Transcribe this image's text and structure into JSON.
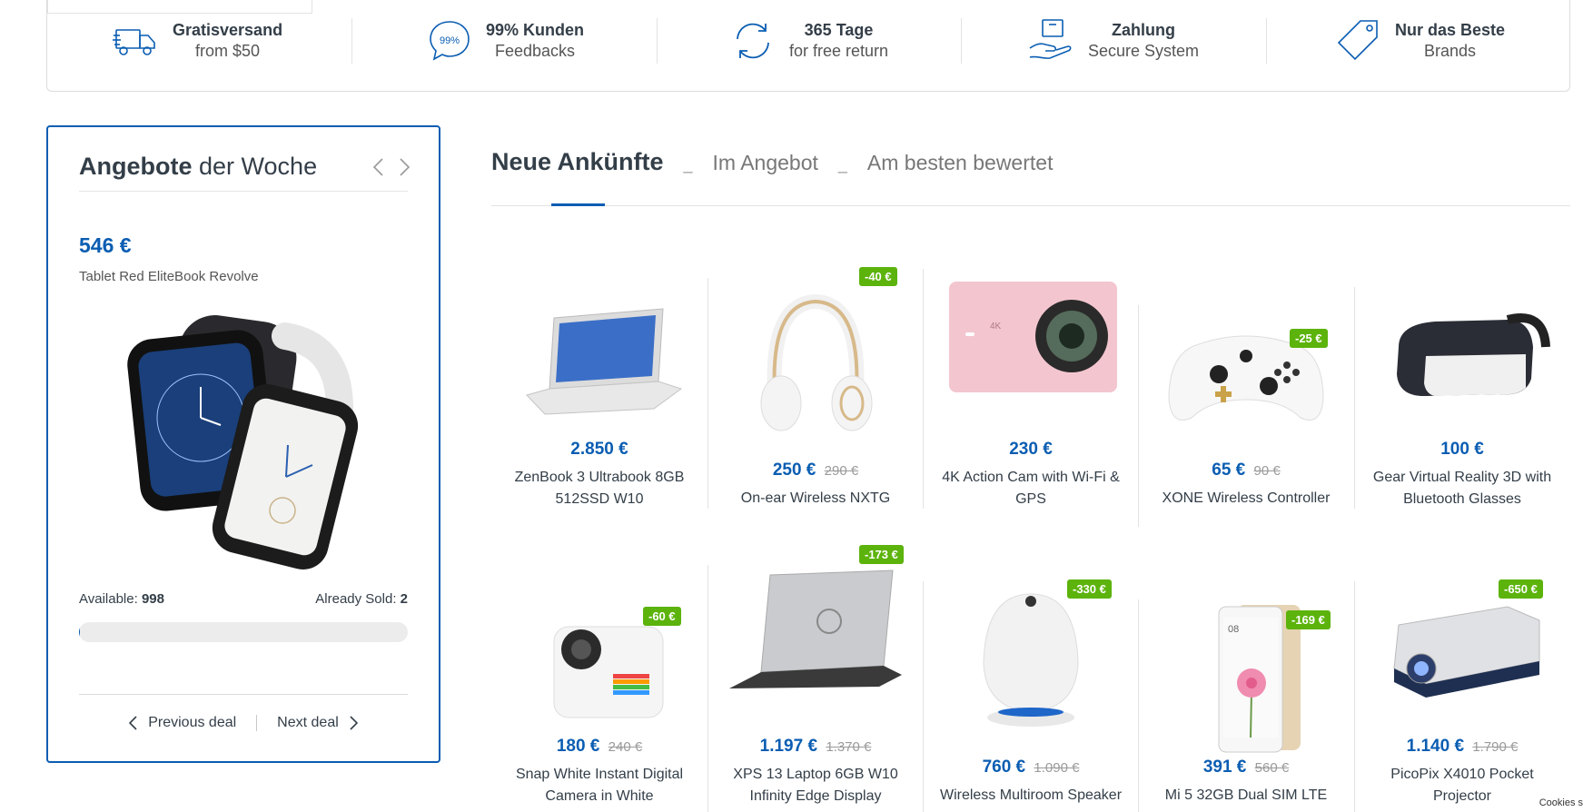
{
  "features": [
    {
      "icon": "truck-icon",
      "title": "Gratisversand",
      "subtitle": "from $50"
    },
    {
      "icon": "feedback-bubble-icon",
      "icon_text": "99%",
      "title": "99% Kunden",
      "subtitle": "Feedbacks"
    },
    {
      "icon": "return-arrows-icon",
      "title": "365 Tage",
      "subtitle": "for free return"
    },
    {
      "icon": "secure-payment-icon",
      "title": "Zahlung",
      "subtitle": "Secure System"
    },
    {
      "icon": "price-tag-icon",
      "title": "Nur das Beste",
      "subtitle": "Brands"
    }
  ],
  "deal": {
    "title_bold": "Angebote",
    "title_light": "der Woche",
    "price": "546 €",
    "product_name": "Tablet Red EliteBook Revolve",
    "available_label": "Available:",
    "available_value": "998",
    "sold_label": "Already Sold:",
    "sold_value": "2",
    "progress_percent": 0.2,
    "prev_label": "Previous deal",
    "next_label": "Next deal"
  },
  "tabs": [
    {
      "label": "Neue Ankünfte",
      "active": true
    },
    {
      "label": "Im Angebot",
      "active": false
    },
    {
      "label": "Am besten bewertet",
      "active": false
    }
  ],
  "tab_separator": "_",
  "products": [
    {
      "name": "ZenBook 3 Ultrabook 8GB 512SSD W10",
      "price": "2.850 €",
      "old_price": "",
      "badge": ""
    },
    {
      "name": "On-ear Wireless NXTG",
      "price": "250 €",
      "old_price": "290 €",
      "badge": "-40 €"
    },
    {
      "name": "4K Action Cam with Wi-Fi & GPS",
      "price": "230 €",
      "old_price": "",
      "badge": ""
    },
    {
      "name": "XONE Wireless Controller",
      "price": "65 €",
      "old_price": "90 €",
      "badge": "-25 €"
    },
    {
      "name": "Gear Virtual Reality 3D with Bluetooth Glasses",
      "price": "100 €",
      "old_price": "",
      "badge": ""
    },
    {
      "name": "Snap White Instant Digital Camera in White",
      "price": "180 €",
      "old_price": "240 €",
      "badge": "-60 €"
    },
    {
      "name": "XPS 13 Laptop 6GB W10 Infinity Edge Display",
      "price": "1.197 €",
      "old_price": "1.370 €",
      "badge": "-173 €"
    },
    {
      "name": "Wireless Multiroom Speaker",
      "price": "760 €",
      "old_price": "1.090 €",
      "badge": "-330 €"
    },
    {
      "name": "Mi 5 32GB Dual SIM LTE",
      "price": "391 €",
      "old_price": "560 €",
      "badge": "-169 €"
    },
    {
      "name": "PicoPix X4010 Pocket Projector",
      "price": "1.140 €",
      "old_price": "1.790 €",
      "badge": "-650 €"
    }
  ],
  "cookies_label": "Cookies s",
  "colors": {
    "accent": "#0a5db2",
    "badge": "#5cb30c",
    "text": "#333e48"
  }
}
